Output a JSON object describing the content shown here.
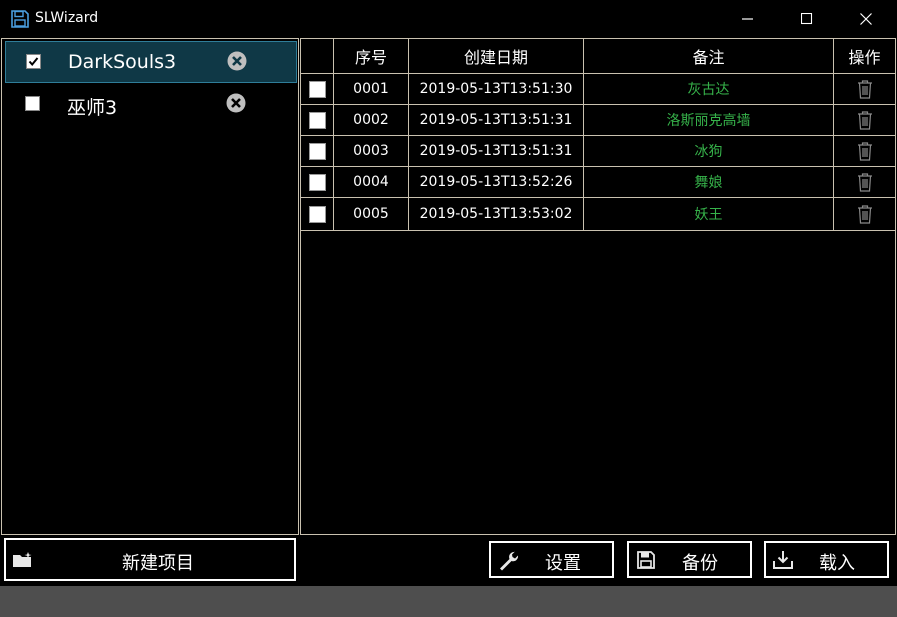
{
  "window": {
    "title": "SLWizard"
  },
  "projects": [
    {
      "name": "DarkSouls3",
      "checked": true,
      "selected": true
    },
    {
      "name": "巫师3",
      "checked": false,
      "selected": false
    }
  ],
  "table": {
    "headers": {
      "seq": "序号",
      "date": "创建日期",
      "note": "备注",
      "op": "操作"
    },
    "rows": [
      {
        "seq": "0001",
        "date": "2019-05-13T13:51:30",
        "note": "灰古达"
      },
      {
        "seq": "0002",
        "date": "2019-05-13T13:51:31",
        "note": "洛斯丽克高墙"
      },
      {
        "seq": "0003",
        "date": "2019-05-13T13:51:31",
        "note": "冰狗"
      },
      {
        "seq": "0004",
        "date": "2019-05-13T13:52:26",
        "note": "舞娘"
      },
      {
        "seq": "0005",
        "date": "2019-05-13T13:53:02",
        "note": "妖王"
      }
    ]
  },
  "buttons": {
    "new_project": "新建项目",
    "settings": "设置",
    "backup": "备份",
    "load": "载入"
  },
  "colors": {
    "accent_note": "#36b24a",
    "selected_bg": "#0f3846",
    "border": "#c9c1b0",
    "status_bar": "#4e4e4e"
  }
}
